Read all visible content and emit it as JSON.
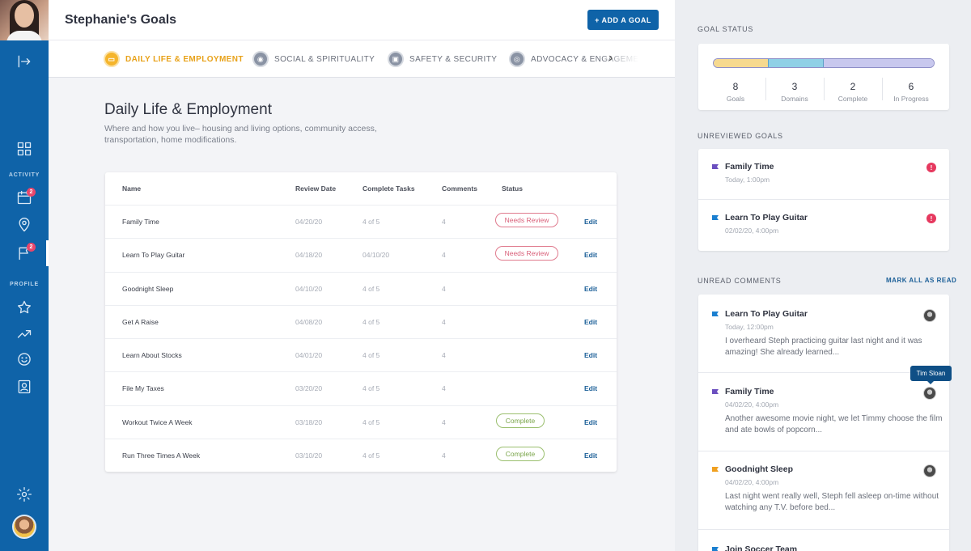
{
  "page": {
    "title": "Stephanie's Goals",
    "add_goal_label": "+ ADD A GOAL"
  },
  "sidebar": {
    "sections": {
      "activity": "ACTIVITY",
      "profile": "PROFILE"
    },
    "badges": {
      "calendar": "2",
      "goals": "2"
    }
  },
  "tabs": [
    {
      "label": "DAILY LIFE & EMPLOYMENT",
      "icon": "briefcase-icon",
      "active": true
    },
    {
      "label": "SOCIAL & SPIRITUALITY",
      "icon": "globe-icon",
      "active": false
    },
    {
      "label": "SAFETY & SECURITY",
      "icon": "lock-icon",
      "active": false
    },
    {
      "label": "ADVOCACY & ENGAGEMENT",
      "icon": "people-icon",
      "active": false
    }
  ],
  "section": {
    "title": "Daily Life & Employment",
    "description": "Where and how you live– housing and living options, community access, transportation, home modifications."
  },
  "table": {
    "headers": {
      "name": "Name",
      "review_date": "Review Date",
      "complete_tasks": "Complete Tasks",
      "comments": "Comments",
      "status": "Status"
    },
    "edit_label": "Edit",
    "rows": [
      {
        "name": "Family Time",
        "review_date": "04/20/20",
        "complete_tasks": "4 of 5",
        "comments": "4",
        "status": "Needs Review"
      },
      {
        "name": "Learn To Play Guitar",
        "review_date": "04/18/20",
        "complete_tasks": "04/10/20",
        "comments": "4",
        "status": "Needs Review"
      },
      {
        "name": "Goodnight Sleep",
        "review_date": "04/10/20",
        "complete_tasks": "4 of 5",
        "comments": "4",
        "status": ""
      },
      {
        "name": "Get A Raise",
        "review_date": "04/08/20",
        "complete_tasks": "4 of 5",
        "comments": "4",
        "status": ""
      },
      {
        "name": "Learn About Stocks",
        "review_date": "04/01/20",
        "complete_tasks": "4 of 5",
        "comments": "4",
        "status": ""
      },
      {
        "name": "File My Taxes",
        "review_date": "03/20/20",
        "complete_tasks": "4 of 5",
        "comments": "4",
        "status": ""
      },
      {
        "name": "Workout Twice A Week",
        "review_date": "03/18/20",
        "complete_tasks": "4 of 5",
        "comments": "4",
        "status": "Complete"
      },
      {
        "name": "Run Three Times A Week",
        "review_date": "03/10/20",
        "complete_tasks": "4 of 5",
        "comments": "4",
        "status": "Complete"
      }
    ]
  },
  "goal_status": {
    "label": "GOAL STATUS",
    "stats": [
      {
        "value": "8",
        "label": "Goals"
      },
      {
        "value": "3",
        "label": "Domains"
      },
      {
        "value": "2",
        "label": "Complete"
      },
      {
        "value": "6",
        "label": "In Progress"
      }
    ],
    "bar_segments": [
      {
        "fraction": 0.25,
        "color": "#f6d98f"
      },
      {
        "fraction": 0.25,
        "color": "#8fd0e6"
      },
      {
        "fraction": 0.5,
        "color": "#c8c8ee"
      }
    ]
  },
  "unreviewed": {
    "label": "UNREVIEWED GOALS",
    "items": [
      {
        "title": "Family Time",
        "time": "Today, 1:00pm",
        "flag_color": "#6b4fbf"
      },
      {
        "title": "Learn To Play Guitar",
        "time": "02/02/20, 4:00pm",
        "flag_color": "#1a7fd0"
      }
    ]
  },
  "comments": {
    "label": "UNREAD COMMENTS",
    "mark_all_label": "MARK ALL AS READ",
    "tooltip": "Tim Sloan",
    "items": [
      {
        "title": "Learn To Play Guitar",
        "time": "Today, 12:00pm",
        "text": "I overheard Steph practicing guitar last night and it was amazing! She already learned...",
        "flag_color": "#1a7fd0"
      },
      {
        "title": "Family Time",
        "time": "04/02/20, 4:00pm",
        "text": "Another awesome movie night, we let Timmy choose the film and ate bowls of popcorn...",
        "flag_color": "#6b4fbf"
      },
      {
        "title": "Goodnight Sleep",
        "time": "04/02/20, 4:00pm",
        "text": "Last night went really well, Steph fell asleep on-time without watching any T.V. before bed...",
        "flag_color": "#f0a020"
      },
      {
        "title": "Join Soccer Team",
        "time": "",
        "text": "",
        "flag_color": "#1a7fd0"
      }
    ]
  }
}
